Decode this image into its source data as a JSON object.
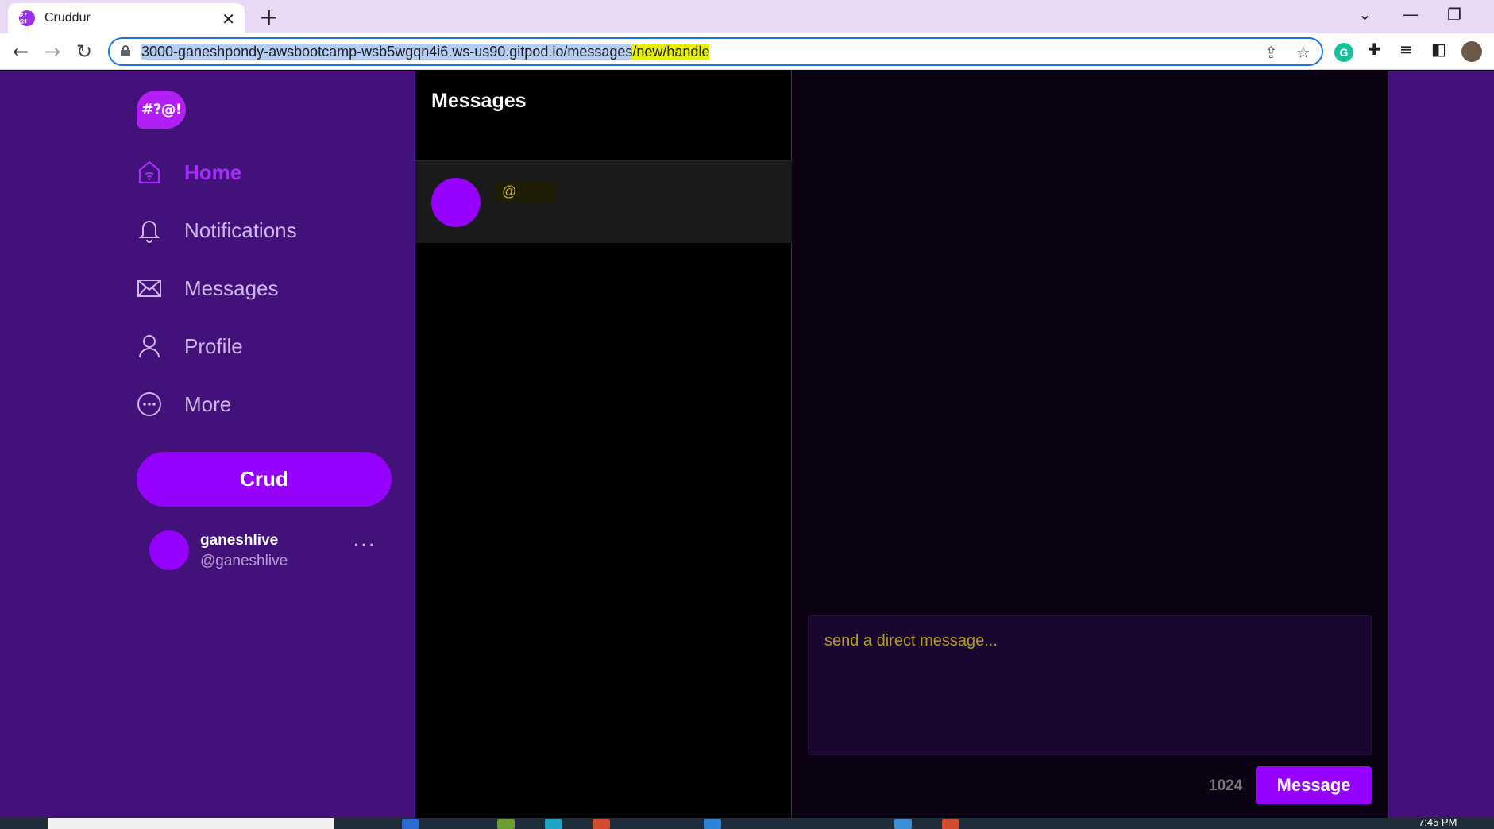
{
  "browser": {
    "tab_title": "Cruddur",
    "favicon_text": "#?@!",
    "new_tab": "+",
    "close_tab": "✕",
    "url_main": "3000-ganeshpondy-awsbootcamp-wsb5wgqn4i6.ws-us90.gitpod.io/messages",
    "url_highlight": "/new/handle",
    "win_min": "—",
    "win_restore": "❐",
    "win_down": "⌄",
    "back": "←",
    "forward": "→",
    "reload": "↻",
    "share_icon": "⇪",
    "star_icon": "☆",
    "extensions_icon": "✚",
    "media_icon": "≡",
    "sidepanel_icon": "◧",
    "grammarly": "G"
  },
  "sidebar": {
    "logo": "#?@!",
    "nav": [
      {
        "label": "Home",
        "active": true
      },
      {
        "label": "Notifications"
      },
      {
        "label": "Messages"
      },
      {
        "label": "Profile"
      },
      {
        "label": "More"
      }
    ],
    "crud_button": "Crud",
    "user": {
      "name": "ganeshlive",
      "handle": "@ganeshlive",
      "more": "···"
    }
  },
  "messages_column": {
    "title": "Messages",
    "conversations": [
      {
        "handle": "@"
      }
    ]
  },
  "chat": {
    "placeholder": "send a direct message...",
    "char_count": "1024",
    "send_button": "Message"
  },
  "taskbar": {
    "clock": "7:45 PM"
  },
  "colors": {
    "accent": "#9500ff",
    "sidebar_bg": "#42117a",
    "active_nav": "#a72cff"
  }
}
